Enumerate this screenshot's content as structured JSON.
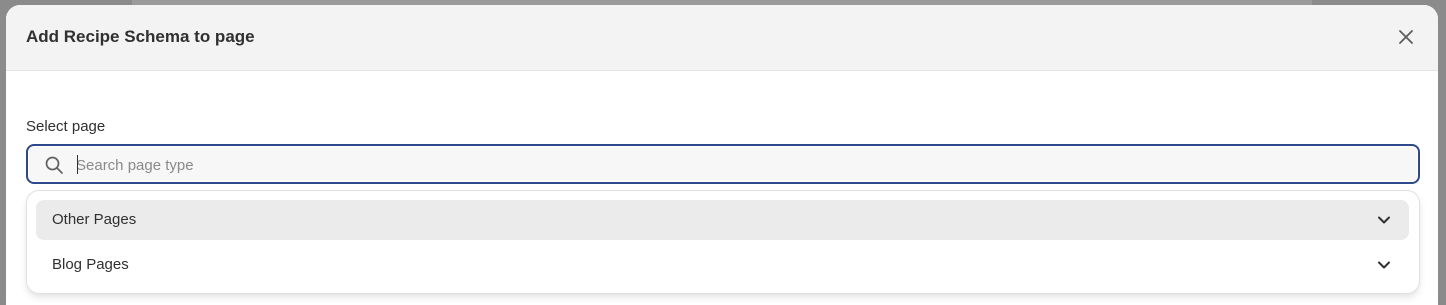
{
  "modal": {
    "title": "Add Recipe Schema to page",
    "close_icon": "close-icon"
  },
  "field": {
    "label": "Select page",
    "placeholder": "Search page type",
    "value": "",
    "icon": "search-icon"
  },
  "dropdown": {
    "options": [
      {
        "label": "Other Pages",
        "icon": "chevron-down-icon",
        "highlighted": true
      },
      {
        "label": "Blog Pages",
        "icon": "chevron-down-icon",
        "highlighted": false
      }
    ]
  },
  "colors": {
    "focus_border": "#2c4a8a",
    "header_bg": "#f3f3f3",
    "highlight_bg": "#ebebeb",
    "text": "#303030"
  }
}
